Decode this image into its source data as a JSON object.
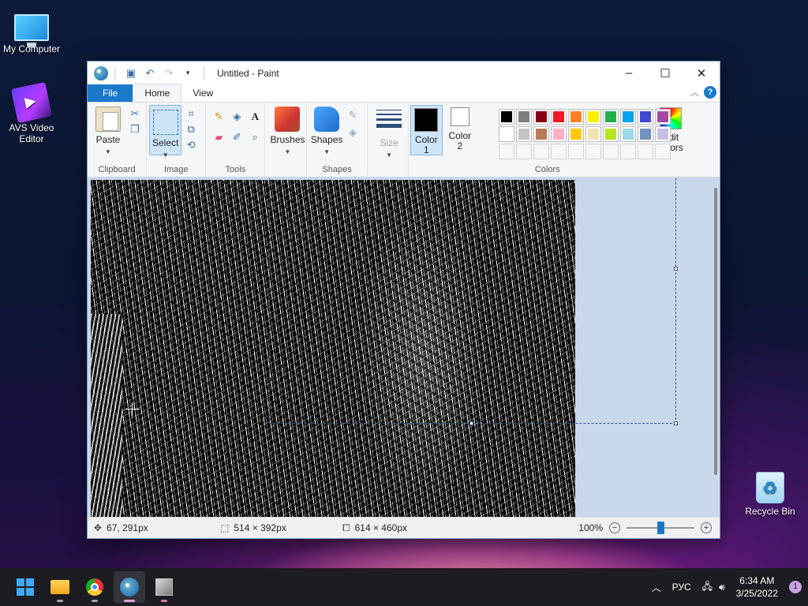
{
  "desktop": {
    "icons": [
      {
        "label": "My Computer"
      },
      {
        "label": "AVS Video Editor"
      },
      {
        "label": "Recycle Bin"
      }
    ]
  },
  "window": {
    "title": "Untitled - Paint",
    "controls": {
      "minimize": "–",
      "maximize": "☐",
      "close": "✕"
    }
  },
  "tabs": {
    "file": "File",
    "home": "Home",
    "view": "View"
  },
  "ribbon": {
    "clipboard": {
      "label": "Clipboard",
      "paste": "Paste"
    },
    "image": {
      "label": "Image",
      "select": "Select"
    },
    "tools": {
      "label": "Tools"
    },
    "brushes": "Brushes",
    "shapes": {
      "label": "Shapes",
      "button": "Shapes"
    },
    "size": "Size",
    "color1": {
      "line1": "Color",
      "line2": "1",
      "value": "#000000"
    },
    "color2": {
      "line1": "Color",
      "line2": "2",
      "value": "#ffffff"
    },
    "colors": {
      "label": "Colors"
    },
    "edit_colors": {
      "line1": "Edit",
      "line2": "colors"
    },
    "palette": [
      "#000000",
      "#7f7f7f",
      "#880015",
      "#ed1c24",
      "#ff7f27",
      "#fff200",
      "#22b14c",
      "#00a2e8",
      "#3f48cc",
      "#a349a4",
      "#ffffff",
      "#c3c3c3",
      "#b97a57",
      "#ffaec9",
      "#ffc90e",
      "#efe4b0",
      "#b5e61d",
      "#99d9ea",
      "#7092be",
      "#c8bfe7"
    ]
  },
  "status": {
    "cursor_pos": "67, 291px",
    "selection_size": "514 × 392px",
    "image_size": "614 × 460px",
    "zoom": "100%",
    "zoom_level": 0.5
  },
  "taskbar": {
    "language": "РУС",
    "time": "6:34 AM",
    "date": "3/25/2022",
    "notifications": "1"
  }
}
